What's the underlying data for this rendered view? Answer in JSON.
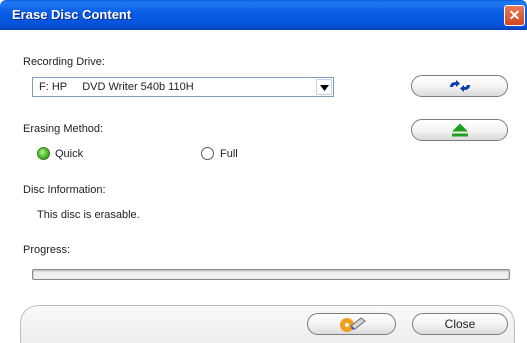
{
  "window": {
    "title": "Erase Disc Content",
    "close_glyph": "✕"
  },
  "recording_drive": {
    "label": "Recording Drive:",
    "selected_value": "F: HP     DVD Writer 540b 110H"
  },
  "side_buttons": {
    "refresh_icon": "refresh-arrows-icon",
    "eject_icon": "eject-icon",
    "eject_color": "#1ea11e",
    "refresh_color": "#0a3fb0"
  },
  "erasing_method": {
    "label": "Erasing Method:",
    "options": [
      {
        "label": "Quick",
        "selected": true
      },
      {
        "label": "Full",
        "selected": false
      }
    ]
  },
  "disc_information": {
    "label": "Disc Information:",
    "text": "This disc is erasable."
  },
  "progress": {
    "label": "Progress:",
    "value": 0
  },
  "footer": {
    "erase_icon": "erase-disc-icon",
    "close_label": "Close"
  }
}
